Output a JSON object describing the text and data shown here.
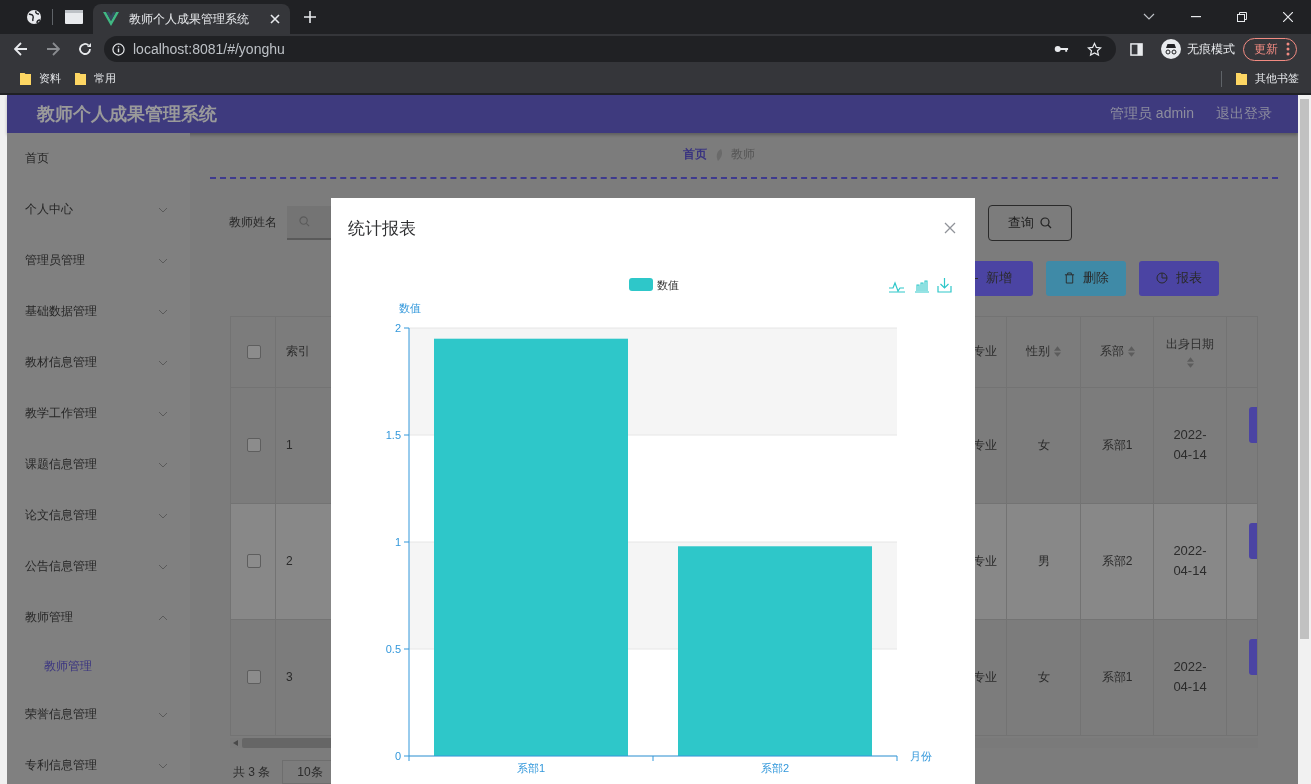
{
  "browser": {
    "tabs": [
      {
        "title": "教师个人成果管理系统",
        "selected": true
      }
    ],
    "address": "localhost:8081/#/yonghu",
    "profile": "无痕模式",
    "update_button": "更新",
    "bookmarks": [
      "资料",
      "常用"
    ],
    "other_bookmarks": "其他书签"
  },
  "header": {
    "title": "教师个人成果管理系统",
    "user": "管理员 admin",
    "logout": "退出登录"
  },
  "sidebar": {
    "items": [
      {
        "label": "首页"
      },
      {
        "label": "个人中心",
        "expanded": false
      },
      {
        "label": "管理员管理",
        "expanded": false
      },
      {
        "label": "基础数据管理",
        "expanded": false
      },
      {
        "label": "教材信息管理",
        "expanded": false
      },
      {
        "label": "教学工作管理",
        "expanded": false
      },
      {
        "label": "课题信息管理",
        "expanded": false
      },
      {
        "label": "论文信息管理",
        "expanded": false
      },
      {
        "label": "公告信息管理",
        "expanded": false
      },
      {
        "label": "教师管理",
        "expanded": true,
        "children": [
          {
            "label": "教师管理",
            "selected": true
          }
        ]
      },
      {
        "label": "荣誉信息管理",
        "expanded": false
      },
      {
        "label": "专利信息管理",
        "expanded": false
      }
    ]
  },
  "breadcrumb": [
    {
      "label": "首页",
      "current": false
    },
    {
      "label": "教师",
      "current": true
    }
  ],
  "search": {
    "label": "教师姓名",
    "query_button": "查询"
  },
  "actions": [
    {
      "label": "新增",
      "kind": "add"
    },
    {
      "label": "删除",
      "kind": "delete"
    },
    {
      "label": "报表",
      "kind": "report"
    }
  ],
  "table": {
    "all_checked": false,
    "columns": [
      {
        "label": "索引",
        "sortable": false
      },
      {
        "label": "专业",
        "sortable": false
      },
      {
        "label": "性别",
        "sortable": true
      },
      {
        "label": "系部",
        "sortable": true
      },
      {
        "label": "出身日期",
        "sortable": true
      }
    ],
    "rows": [
      {
        "index": "1",
        "major": "专业",
        "gender": "女",
        "dept": "系部1",
        "birth": "2022-04-14",
        "checked": false,
        "highlighted": false
      },
      {
        "index": "2",
        "major": "专业",
        "gender": "男",
        "dept": "系部2",
        "birth": "2022-04-14",
        "checked": false,
        "highlighted": true
      },
      {
        "index": "3",
        "major": "专业",
        "gender": "女",
        "dept": "系部1",
        "birth": "2022-04-14",
        "checked": false,
        "highlighted": false
      }
    ]
  },
  "pagination": {
    "total": "共 3 条",
    "page_size": "10条"
  },
  "modal": {
    "title": "统计报表",
    "chart_data": {
      "type": "bar",
      "xlabel": "月份",
      "ylabel": "数值",
      "categories": [
        "系部1",
        "系部2"
      ],
      "series": [
        {
          "name": "数值",
          "color": "#2ec7c9",
          "values": [
            1.95,
            0.98
          ]
        }
      ],
      "grid": true,
      "ylim": [
        0,
        2
      ],
      "yticks": [
        0,
        0.5,
        1,
        1.5,
        2
      ]
    }
  }
}
